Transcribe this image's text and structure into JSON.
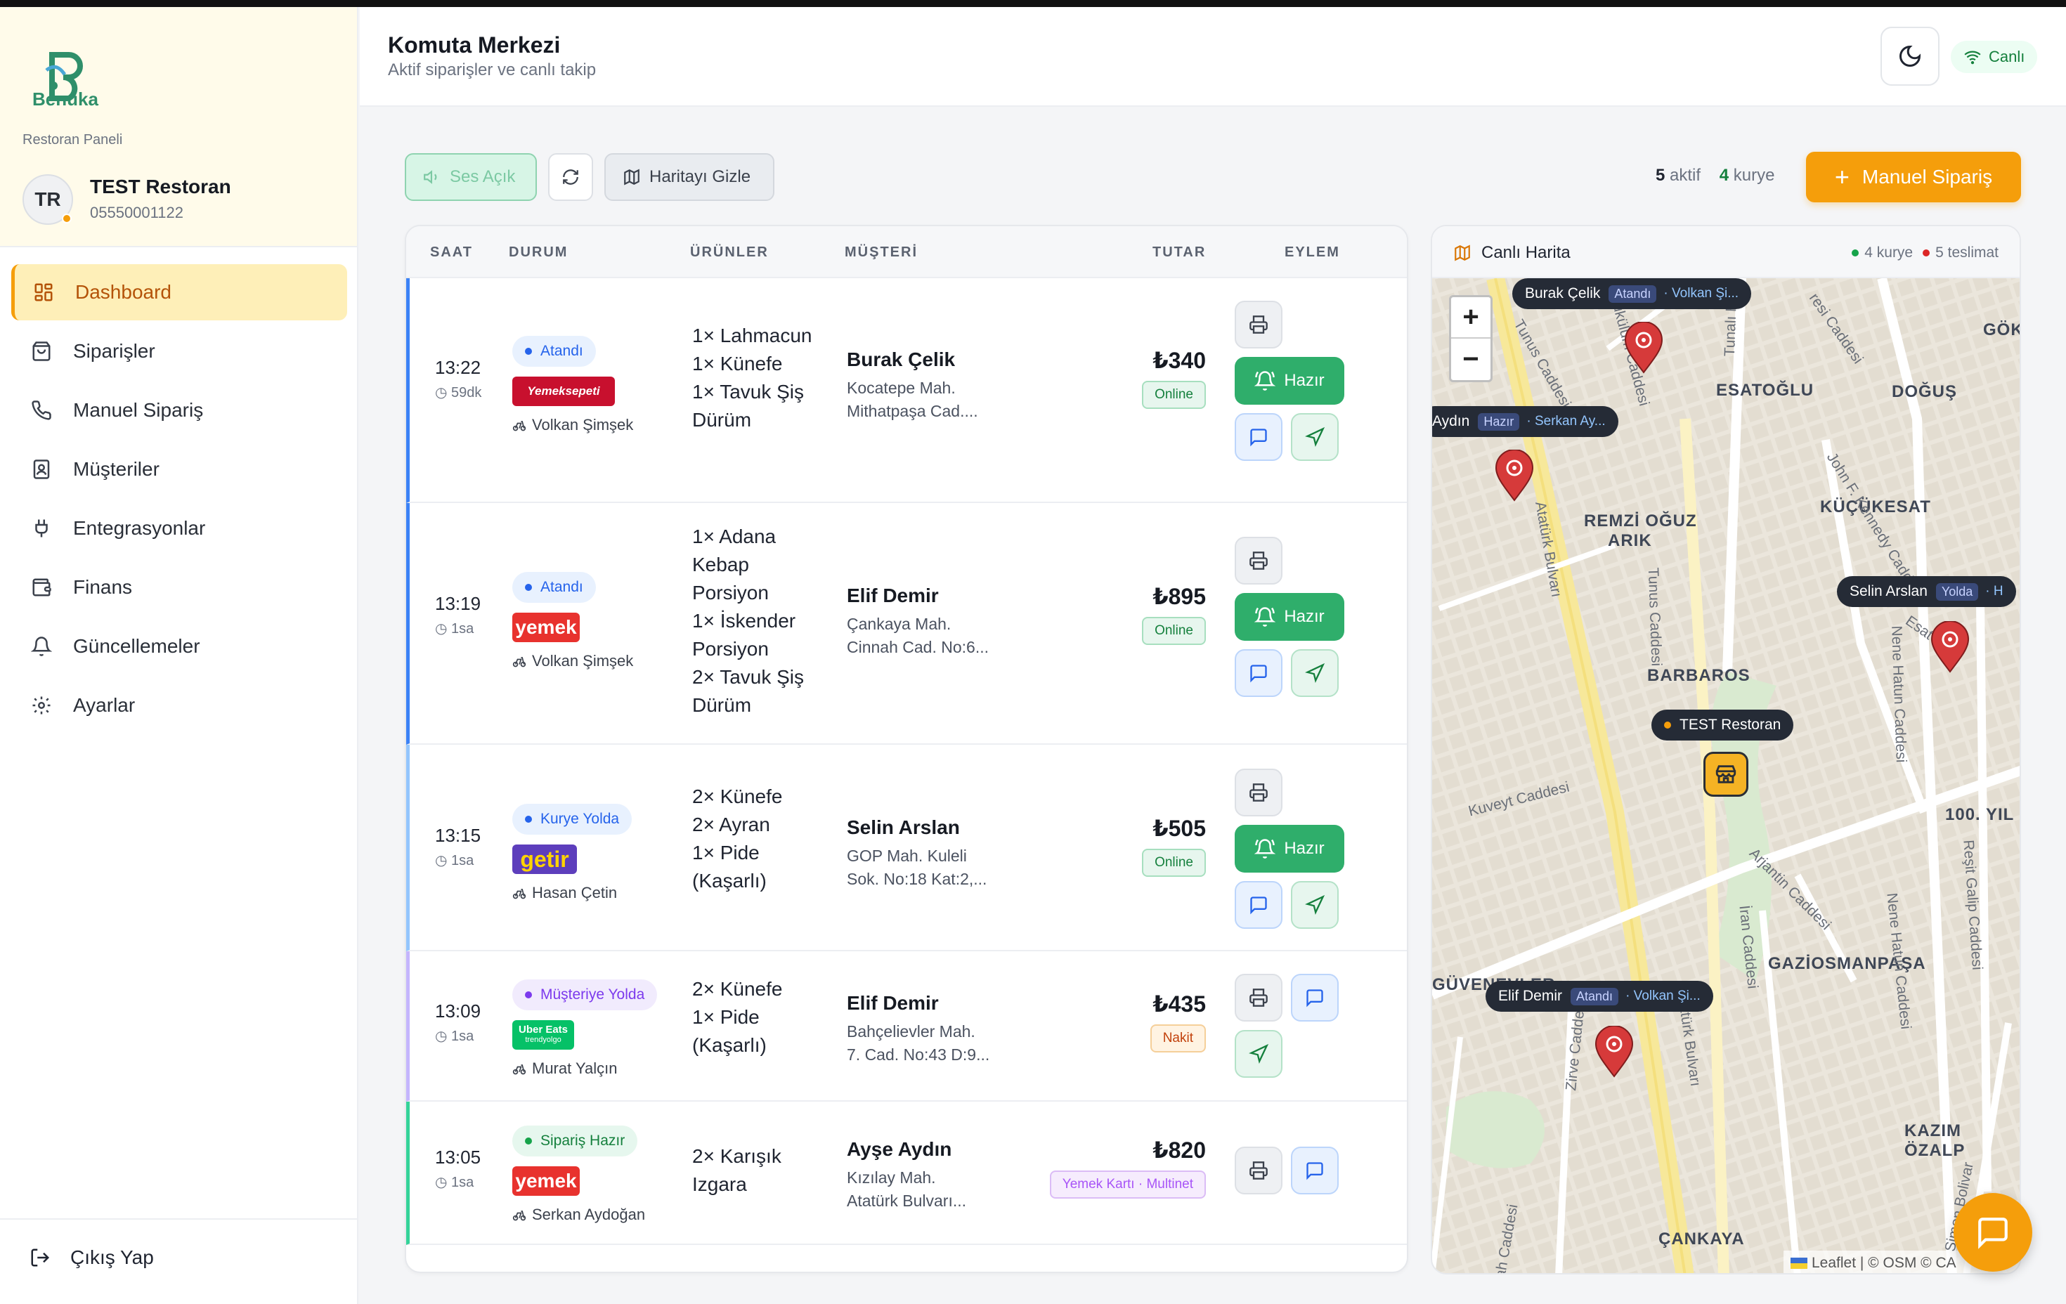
{
  "brand": {
    "name": "Benuka",
    "panel_label": "Restoran Paneli"
  },
  "user": {
    "initials": "TR",
    "restaurant": "TEST Restoran",
    "phone": "05550001122"
  },
  "nav": [
    {
      "label": "Dashboard",
      "icon": "grid-icon",
      "active": true
    },
    {
      "label": "Siparişler",
      "icon": "bag-icon"
    },
    {
      "label": "Manuel Sipariş",
      "icon": "phone-icon"
    },
    {
      "label": "Müşteriler",
      "icon": "contact-icon"
    },
    {
      "label": "Entegrasyonlar",
      "icon": "plug-icon"
    },
    {
      "label": "Finans",
      "icon": "wallet-icon"
    },
    {
      "label": "Güncellemeler",
      "icon": "bell-icon"
    },
    {
      "label": "Ayarlar",
      "icon": "gear-icon"
    }
  ],
  "logout": "Çıkış Yap",
  "header": {
    "title": "Komuta Merkezi",
    "subtitle": "Aktif siparişler ve canlı takip",
    "live": "Canlı"
  },
  "toolbar": {
    "sound": "Ses Açık",
    "hide_map": "Haritayı Gizle",
    "active_count": "5",
    "active_label": "aktif",
    "courier_count": "4",
    "courier_label": "kurye",
    "manual_order": "Manuel Sipariş"
  },
  "table": {
    "headers": {
      "time": "SAAT",
      "status": "DURUM",
      "products": "ÜRÜNLER",
      "customer": "MÜŞTERİ",
      "amount": "TUTAR",
      "action": "EYLEM"
    },
    "ready_label": "Hazır",
    "rows": [
      {
        "time": "13:22",
        "ago": "59dk",
        "status": "Atandı",
        "platform": "Yemeksepeti",
        "courier": "Volkan Şimşek",
        "items": [
          "1× Lahmacun",
          "1× Künefe",
          "1× Tavuk Şiş Dürüm"
        ],
        "customer": "Burak Çelik",
        "addr1": "Kocatepe Mah.",
        "addr2": "Mithatpaşa Cad....",
        "amount": "₺340",
        "payment": "Online"
      },
      {
        "time": "13:19",
        "ago": "1sa",
        "status": "Atandı",
        "platform": "yemek",
        "courier": "Volkan Şimşek",
        "items": [
          "1× Adana Kebap Porsiyon",
          "1× İskender Porsiyon",
          "2× Tavuk Şiş Dürüm"
        ],
        "customer": "Elif Demir",
        "addr1": "Çankaya Mah.",
        "addr2": "Cinnah Cad. No:6...",
        "amount": "₺895",
        "payment": "Online"
      },
      {
        "time": "13:15",
        "ago": "1sa",
        "status": "Kurye Yolda",
        "platform": "getir",
        "courier": "Hasan Çetin",
        "items": [
          "2× Künefe",
          "2× Ayran",
          "1× Pide (Kaşarlı)"
        ],
        "customer": "Selin Arslan",
        "addr1": "GOP Mah. Kuleli",
        "addr2": "Sok. No:18 Kat:2,...",
        "amount": "₺505",
        "payment": "Online"
      },
      {
        "time": "13:09",
        "ago": "1sa",
        "status": "Müşteriye Yolda",
        "platform": "Uber Eats",
        "platform_sub": "trendyolgo",
        "courier": "Murat Yalçın",
        "items": [
          "2× Künefe",
          "1× Pide (Kaşarlı)"
        ],
        "customer": "Elif Demir",
        "addr1": "Bahçelievler Mah.",
        "addr2": "7. Cad. No:43 D:9...",
        "amount": "₺435",
        "payment": "Nakit"
      },
      {
        "time": "13:05",
        "ago": "1sa",
        "status": "Sipariş Hazır",
        "platform": "yemek",
        "courier": "Serkan Aydoğan",
        "items": [
          "2× Karışık Izgara"
        ],
        "customer": "Ayşe Aydın",
        "addr1": "Kızılay Mah.",
        "addr2": "Atatürk Bulvarı...",
        "amount": "₺820",
        "payment": "Yemek Kartı · Multinet"
      }
    ]
  },
  "map": {
    "title": "Canlı Harita",
    "legend_couriers": "4 kurye",
    "legend_deliveries": "5 teslimat",
    "districts": [
      "GÖK",
      "ESATOĞLU",
      "DOĞUŞ",
      "KÜÇÜKESAT",
      "REMZİ OĞUZ",
      "ARIK",
      "BARBAROS",
      "100. YIL",
      "GAZİOSMANPAŞA",
      "GÜVENEVLER",
      "KAZIM ÖZALP",
      "ÇANKAYA"
    ],
    "streets": [
      "Tunus Caddesi",
      "Bükülüm Caddesi",
      "Tunalı H",
      "resi Caddesi",
      "John F. Kennedy Caddesi",
      "Atatürk Bulvarı",
      "Tunus Caddesi",
      "Esat C",
      "Nene Hatun Caddesi",
      "Kuveyt Caddesi",
      "Arjantin Caddesi",
      "İran Caddesi",
      "Reşit Galip Caddesi",
      "Simon Bolivar",
      "Nene Hatun Caddesi",
      "Atatürk Bulvarı",
      "Zirve Caddesi",
      "Cinnah Caddesi"
    ],
    "tooltips": [
      {
        "name": "Burak Çelik",
        "status": "Atandı",
        "courier": "· Volkan Şi..."
      },
      {
        "name": "Aydın",
        "status": "Hazır",
        "courier": "· Serkan Ay..."
      },
      {
        "name": "Selin Arslan",
        "status": "Yolda",
        "courier": "· H"
      },
      {
        "name": "Elif Demir",
        "status": "Atandı",
        "courier": "· Volkan Şi..."
      },
      {
        "name": "TEST Restoran"
      }
    ],
    "attribution": "Leaflet | © OSM © CA"
  },
  "colors": {
    "accent": "#f59e0b",
    "success": "#2fae6b",
    "primary": "#3b82f6",
    "danger": "#dc3545"
  }
}
